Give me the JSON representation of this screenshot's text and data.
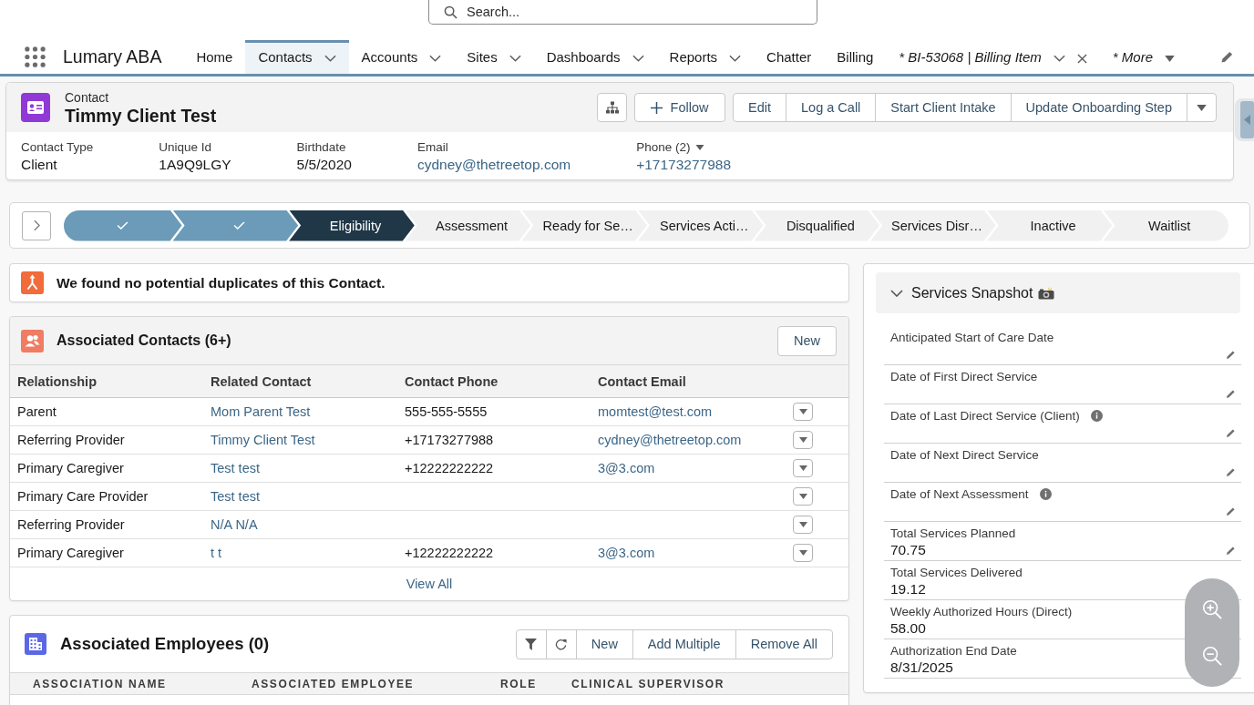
{
  "global_search": {
    "placeholder": "Search..."
  },
  "app_name": "Lumary ABA",
  "nav_items": [
    {
      "label": "Home",
      "kind": "link",
      "selected": false,
      "dropdown": false
    },
    {
      "label": "Contacts",
      "kind": "link",
      "selected": true,
      "dropdown": true
    },
    {
      "label": "Accounts",
      "kind": "link",
      "selected": false,
      "dropdown": true
    },
    {
      "label": "Sites",
      "kind": "link",
      "selected": false,
      "dropdown": true
    },
    {
      "label": "Dashboards",
      "kind": "link",
      "selected": false,
      "dropdown": true
    },
    {
      "label": "Reports",
      "kind": "link",
      "selected": false,
      "dropdown": true
    },
    {
      "label": "Chatter",
      "kind": "link",
      "selected": false,
      "dropdown": false
    },
    {
      "label": "Billing",
      "kind": "link",
      "selected": false,
      "dropdown": false
    },
    {
      "label": "* BI-53068 | Billing Item",
      "kind": "workspace_tab",
      "selected": false,
      "dropdown": true
    },
    {
      "label": "* More",
      "kind": "more",
      "selected": false,
      "dropdown": true
    }
  ],
  "record": {
    "object_label": "Contact",
    "name": "Timmy Client Test",
    "actions": [
      {
        "kind": "hierarchy"
      },
      {
        "kind": "follow",
        "label": "Follow"
      }
    ],
    "action_group": [
      "Edit",
      "Log a Call",
      "Start Client Intake",
      "Update Onboarding Step"
    ],
    "highlights": [
      {
        "label": "Contact Type",
        "value": "Client",
        "kind": "text",
        "dropdown": false
      },
      {
        "label": "Unique Id",
        "value": "1A9Q9LGY",
        "kind": "text",
        "dropdown": false
      },
      {
        "label": "Birthdate",
        "value": "5/5/2020",
        "kind": "text",
        "dropdown": false
      },
      {
        "label": "Email",
        "value": "cydney@thetreetop.com",
        "kind": "link",
        "dropdown": false
      },
      {
        "label": "Phone (2)",
        "value": "+17173277988",
        "kind": "link",
        "dropdown": true
      }
    ]
  },
  "path": {
    "stages": [
      {
        "completed": true,
        "selected": false
      },
      {
        "completed": true,
        "selected": false
      },
      {
        "label": "Eligibility",
        "completed": false,
        "selected": true
      },
      {
        "label": "Assessment",
        "completed": false,
        "selected": false
      },
      {
        "label": "Ready for Se…",
        "completed": false,
        "selected": false
      },
      {
        "label": "Services Acti…",
        "completed": false,
        "selected": false
      },
      {
        "label": "Disqualified",
        "completed": false,
        "selected": false
      },
      {
        "label": "Services Disr…",
        "completed": false,
        "selected": false
      },
      {
        "label": "Inactive",
        "completed": false,
        "selected": false
      },
      {
        "label": "Waitlist",
        "completed": false,
        "selected": false
      }
    ]
  },
  "duplicate_alert": {
    "message": "We found no potential duplicates of this Contact."
  },
  "associated_contacts": {
    "title": "Associated Contacts (6+)",
    "new_button": "New",
    "columns": [
      "Relationship",
      "Related Contact",
      "Contact Phone",
      "Contact Email"
    ],
    "rows": [
      {
        "relationship": "Parent",
        "related_contact": "Mom Parent Test",
        "phone": "555-555-5555",
        "email": "momtest@test.com"
      },
      {
        "relationship": "Referring Provider",
        "related_contact": "Timmy Client Test",
        "phone": "+17173277988",
        "email": "cydney@thetreetop.com"
      },
      {
        "relationship": "Primary Caregiver",
        "related_contact": "Test test",
        "phone": "+12222222222",
        "email": "3@3.com"
      },
      {
        "relationship": "Primary Care Provider",
        "related_contact": "Test test"
      },
      {
        "relationship": "Referring Provider",
        "related_contact": "N/A N/A"
      },
      {
        "relationship": "Primary Caregiver",
        "related_contact": "t t",
        "phone": "+12222222222",
        "email": "3@3.com"
      }
    ],
    "view_all": "View All"
  },
  "associated_employees": {
    "title": "Associated Employees (0)",
    "buttons": [
      {
        "kind": "filter"
      },
      {
        "kind": "refresh"
      },
      {
        "kind": "text",
        "label": "New"
      },
      {
        "kind": "text",
        "label": "Add Multiple"
      },
      {
        "kind": "text",
        "label": "Remove All"
      }
    ],
    "columns": [
      "ASSOCIATION NAME",
      "ASSOCIATED EMPLOYEE",
      "ROLE",
      "CLINICAL SUPERVISOR"
    ]
  },
  "services_snapshot": {
    "title": "Services Snapshot",
    "expanded": true,
    "fields": [
      {
        "label": "Anticipated Start of Care Date",
        "info": false,
        "editable": true
      },
      {
        "label": "Date of First Direct Service",
        "info": false,
        "editable": true
      },
      {
        "label": "Date of Last Direct Service (Client)",
        "info": true,
        "editable": true
      },
      {
        "label": "Date of Next Direct Service",
        "info": false,
        "editable": true
      },
      {
        "label": "Date of Next Assessment",
        "info": true,
        "editable": true
      },
      {
        "label": "Total Services Planned",
        "value": "70.75",
        "info": false,
        "editable": true
      },
      {
        "label": "Total Services Delivered",
        "value": "19.12",
        "info": false,
        "editable": false
      },
      {
        "label": "Weekly Authorized Hours (Direct)",
        "value": "58.00",
        "info": false,
        "editable": false
      },
      {
        "label": "Authorization End Date",
        "value": "8/31/2025",
        "info": false,
        "editable": false
      }
    ]
  }
}
